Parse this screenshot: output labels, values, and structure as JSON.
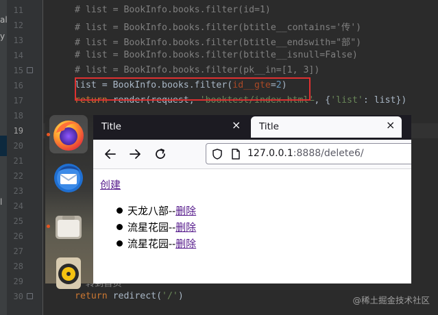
{
  "ide": {
    "sidebar_fragments": [
      "al.",
      "y",
      "l"
    ],
    "lines": [
      {
        "num": "11",
        "segments": [
          {
            "t": "# list = BookInfo.books.filter(id=1)",
            "c": "cm"
          }
        ]
      },
      {
        "num": "12",
        "segments": [
          {
            "t": "# list = BookInfo.books.filter(btitle__contains='传')",
            "c": "cm"
          }
        ]
      },
      {
        "num": "13",
        "segments": [
          {
            "t": "# list = BookInfo.books.filter(btitle__endswith=\"部\")",
            "c": "cm"
          }
        ]
      },
      {
        "num": "14",
        "segments": [
          {
            "t": "# list = BookInfo.books.filter(btitle__isnull=False)",
            "c": "cm"
          }
        ]
      },
      {
        "num": "15",
        "segments": [
          {
            "t": "# list = BookInfo.books.filter(pk__in=[1, 3])",
            "c": "cm"
          }
        ]
      },
      {
        "num": "16",
        "segments": [
          {
            "t": "list = BookInfo.books.filter(",
            "c": ""
          },
          {
            "t": "id__gte",
            "c": "kwarg"
          },
          {
            "t": "=",
            "c": ""
          },
          {
            "t": "2",
            "c": "num"
          },
          {
            "t": ")",
            "c": ""
          }
        ]
      },
      {
        "num": "17",
        "segments": [
          {
            "t": "return",
            "c": "kw strike"
          },
          {
            "t": " render(request, ",
            "c": "strike"
          },
          {
            "t": "'booktest/index.html'",
            "c": "str strike"
          },
          {
            "t": ", {",
            "c": ""
          },
          {
            "t": "'list'",
            "c": "str"
          },
          {
            "t": ": list})",
            "c": ""
          }
        ]
      },
      {
        "num": "18",
        "segments": []
      },
      {
        "num": "19",
        "segments": []
      },
      {
        "num": "20",
        "segments": []
      },
      {
        "num": "21",
        "segments": []
      },
      {
        "num": "22",
        "segments": []
      },
      {
        "num": "23",
        "segments": []
      },
      {
        "num": "24",
        "segments": []
      },
      {
        "num": "25",
        "segments": []
      },
      {
        "num": "26",
        "segments": []
      },
      {
        "num": "27",
        "segments": []
      },
      {
        "num": "28",
        "segments": []
      },
      {
        "num": "29",
        "segments": [
          {
            "t": "# 转到首页",
            "c": "cm"
          }
        ]
      },
      {
        "num": "30",
        "segments": [
          {
            "t": "return",
            "c": "kw"
          },
          {
            "t": " redirect(",
            "c": ""
          },
          {
            "t": "'/'",
            "c": "str"
          },
          {
            "t": ")",
            "c": ""
          }
        ]
      }
    ],
    "current_line": "19"
  },
  "watermark": "@稀土掘金技术社区",
  "dock": {
    "items": [
      {
        "name": "firefox-icon",
        "active": true,
        "running": true
      },
      {
        "name": "thunderbird-icon",
        "active": false,
        "running": false
      },
      {
        "name": "files-icon",
        "active": false,
        "running": true
      },
      {
        "name": "rhythmbox-icon",
        "active": false,
        "running": false
      }
    ]
  },
  "browser": {
    "tabs": [
      {
        "title": "Title",
        "close": "×"
      },
      {
        "title": "Title",
        "close": "×"
      }
    ],
    "url": {
      "host": "127.0.0.1",
      "rest": ":8888/delete6/"
    },
    "page": {
      "create_link": "创建",
      "books": [
        {
          "name": "天龙八部",
          "sep": "--",
          "action": "删除"
        },
        {
          "name": "流星花园",
          "sep": "--",
          "action": "删除"
        },
        {
          "name": "流星花园",
          "sep": "--",
          "action": "删除"
        }
      ]
    }
  },
  "colors": {
    "ide_bg": "#2b2b2b",
    "highlight_box": "#e03131",
    "visited_link": "#551a8b",
    "firefox_tab_bar": "#1c1b22"
  }
}
